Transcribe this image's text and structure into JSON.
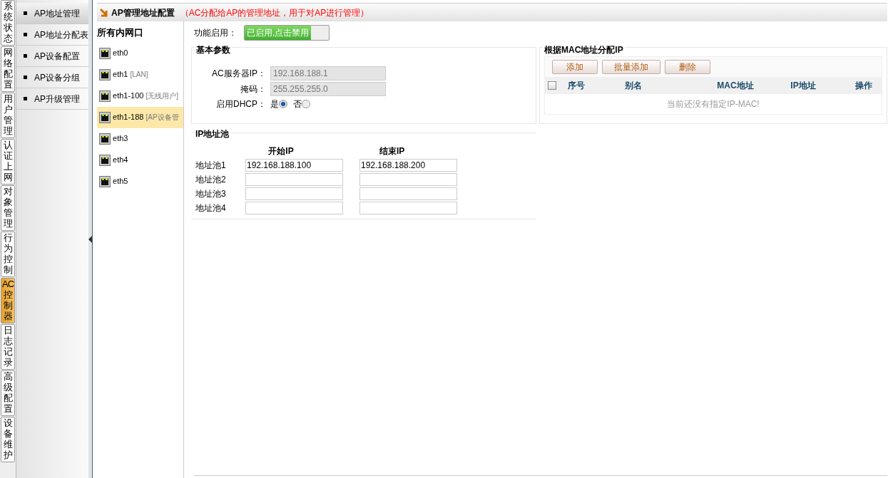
{
  "main_tabs": [
    {
      "label": "系统状态",
      "selected": false
    },
    {
      "label": "网络配置",
      "selected": false
    },
    {
      "label": "用户管理",
      "selected": false
    },
    {
      "label": "认证上网",
      "selected": false
    },
    {
      "label": "对象管理",
      "selected": false
    },
    {
      "label": "行为控制",
      "selected": false
    },
    {
      "label": "AC控制器",
      "selected": true
    },
    {
      "label": "日志记录",
      "selected": false
    },
    {
      "label": "高级配置",
      "selected": false
    },
    {
      "label": "设备维护",
      "selected": false
    }
  ],
  "sub_menu": [
    {
      "label": "AP地址管理",
      "selected": true
    },
    {
      "label": "AP地址分配表",
      "selected": false
    },
    {
      "label": "AP设备配置",
      "selected": false
    },
    {
      "label": "AP设备分组",
      "selected": false
    },
    {
      "label": "AP升级管理",
      "selected": false
    }
  ],
  "header": {
    "title": "AP管理地址配置",
    "note": "（AC分配给AP的管理地址，用于对AP进行管理）"
  },
  "interfaces": {
    "title": "所有内网口",
    "items": [
      {
        "name": "eth0",
        "selected": false
      },
      {
        "name": "eth1",
        "tag": "[LAN]",
        "selected": false
      },
      {
        "name": "eth1-100",
        "tag": "[无线用户]",
        "selected": false
      },
      {
        "name": "eth1-188",
        "tag": "[AP设备管",
        "selected": true
      },
      {
        "name": "eth3",
        "selected": false
      },
      {
        "name": "eth4",
        "selected": false
      },
      {
        "name": "eth5",
        "selected": false
      }
    ]
  },
  "feature": {
    "label": "功能启用：",
    "toggle_text": "已启用,点击禁用",
    "on": true
  },
  "basic": {
    "title": "基本参数",
    "server_ip_label": "AC服务器IP：",
    "server_ip": "192.168.188.1",
    "mask_label": "掩码：",
    "mask": "255.255.255.0",
    "dhcp_label": "启用DHCP：",
    "dhcp_options": [
      {
        "label": "是",
        "selected": true
      },
      {
        "label": "否",
        "selected": false
      }
    ]
  },
  "pool": {
    "title": "IP地址池",
    "start_header": "开始IP",
    "end_header": "结束IP",
    "rows": [
      {
        "label": "地址池1",
        "start": "192.168.188.100",
        "end": "192.168.188.200"
      },
      {
        "label": "地址池2",
        "start": "",
        "end": ""
      },
      {
        "label": "地址池3",
        "start": "",
        "end": ""
      },
      {
        "label": "地址池4",
        "start": "",
        "end": ""
      }
    ]
  },
  "mac": {
    "title": "根据MAC地址分配IP",
    "buttons": [
      "添加",
      "批量添加",
      "删除"
    ],
    "columns": [
      "序号",
      "别名",
      "MAC地址",
      "IP地址",
      "操作"
    ],
    "select_all": false,
    "empty": "当前还没有指定IP-MAC!"
  }
}
